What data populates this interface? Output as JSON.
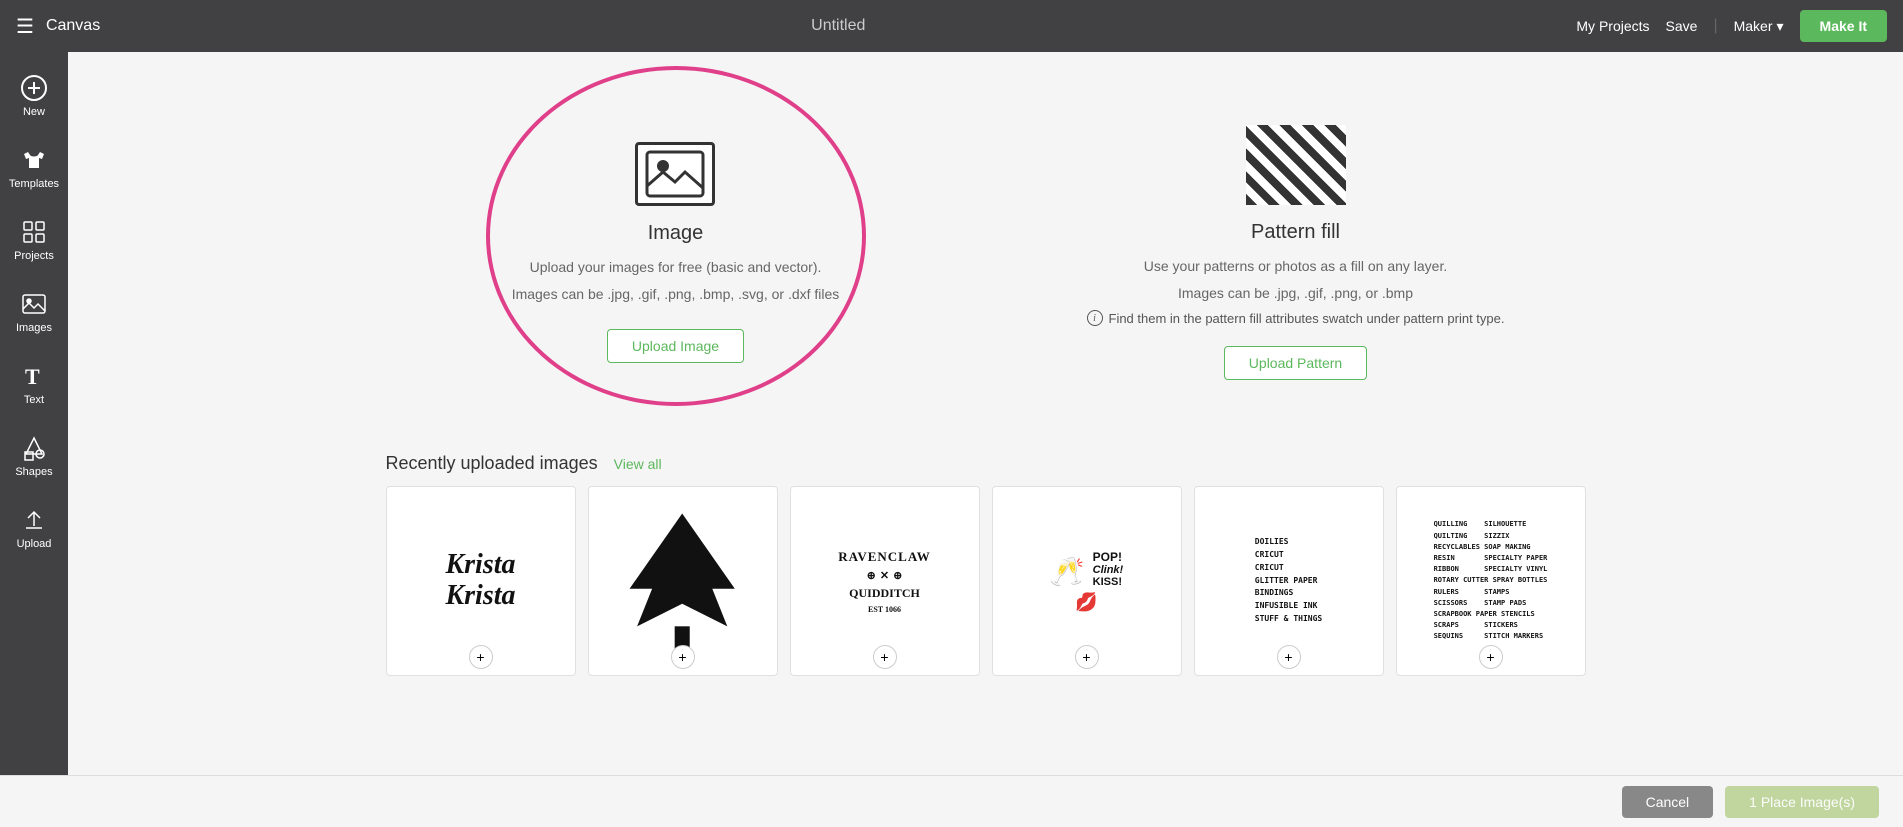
{
  "header": {
    "hamburger": "☰",
    "app_name": "Canvas",
    "doc_title": "Untitled",
    "my_projects_label": "My Projects",
    "save_label": "Save",
    "maker_label": "Maker",
    "make_it_label": "Make It"
  },
  "sidebar": {
    "items": [
      {
        "id": "new",
        "label": "New",
        "icon": "plus"
      },
      {
        "id": "templates",
        "label": "Templates",
        "icon": "tshirt"
      },
      {
        "id": "projects",
        "label": "Projects",
        "icon": "grid"
      },
      {
        "id": "images",
        "label": "Images",
        "icon": "image"
      },
      {
        "id": "text",
        "label": "Text",
        "icon": "text"
      },
      {
        "id": "shapes",
        "label": "Shapes",
        "icon": "shapes"
      },
      {
        "id": "upload",
        "label": "Upload",
        "icon": "upload"
      }
    ]
  },
  "image_card": {
    "title": "Image",
    "desc1": "Upload your images for free (basic and vector).",
    "desc2": "Images can be .jpg, .gif, .png, .bmp, .svg, or .dxf files",
    "upload_btn": "Upload Image"
  },
  "pattern_card": {
    "title": "Pattern fill",
    "desc1": "Use your patterns or photos as a fill on any layer.",
    "desc2": "Images can be .jpg, .gif, .png, or .bmp",
    "info": "Find them in the pattern fill attributes swatch under pattern print type.",
    "upload_btn": "Upload Pattern"
  },
  "recently_uploaded": {
    "title": "Recently uploaded images",
    "view_all": "View all"
  },
  "thumbnails": [
    {
      "id": "krista",
      "type": "text",
      "content": "Krista\nKrista"
    },
    {
      "id": "tree",
      "type": "tree"
    },
    {
      "id": "ravenclaw",
      "type": "ravenclaw"
    },
    {
      "id": "pop",
      "type": "pop"
    },
    {
      "id": "wordlist1",
      "type": "wordlist1"
    },
    {
      "id": "wordlist2",
      "type": "wordlist2"
    }
  ],
  "bottom_bar": {
    "cancel_label": "Cancel",
    "create_label": "1 Place Image(s)"
  }
}
